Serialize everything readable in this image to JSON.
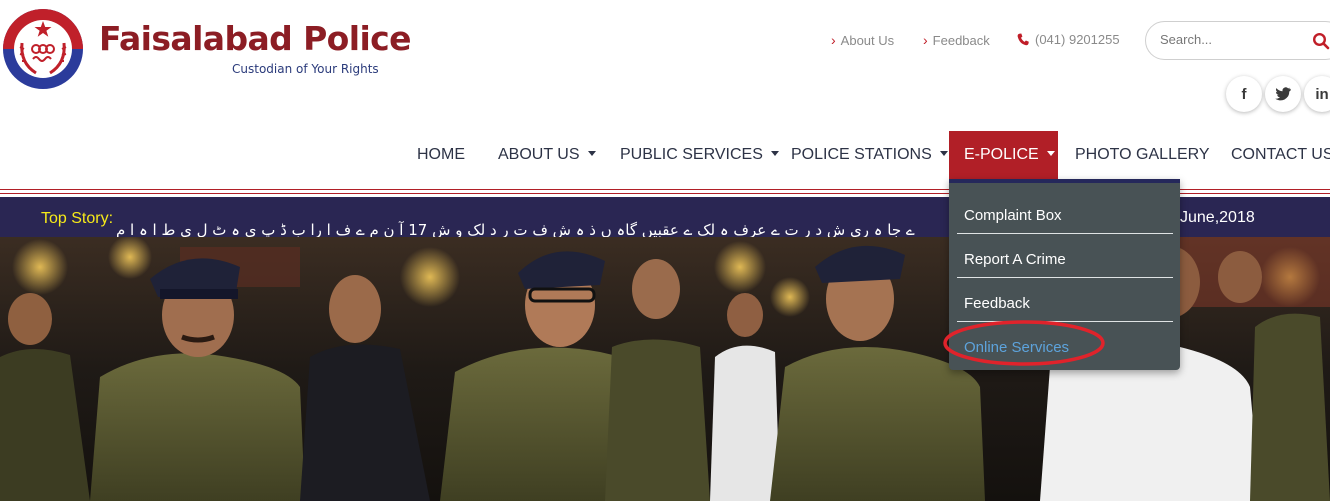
{
  "brand": {
    "name": "Faisalabad Police",
    "tagline": "Custodian of Your Rights"
  },
  "top_links": [
    {
      "label": "About Us"
    },
    {
      "label": "Feedback"
    }
  ],
  "phone": "(041) 9201255",
  "search": {
    "placeholder": "Search..."
  },
  "social": [
    {
      "icon": "facebook-icon",
      "glyph": "f"
    },
    {
      "icon": "twitter-icon",
      "glyph": "t"
    },
    {
      "icon": "linkedin-icon",
      "glyph": "in"
    }
  ],
  "nav": {
    "home": "HOME",
    "about": "ABOUT US",
    "public_services": "PUBLIC SERVICES",
    "police_stations": "POLICE STATIONS",
    "e_police": "E-POLICE",
    "photo_gallery": "PHOTO GALLERY",
    "contact": "CONTACT US"
  },
  "ticker": {
    "label": "Top Story:",
    "text": "ے جا ہ ری ش د ر ت ے عرف ہ لک ے عقبیں  گاہ ں ذ ہ ش ف ت ر د لک و ش 17  آ ن م ے ف ا را ب ڈ پ ی ہ ٹ ل ی ط ا ہ ا م",
    "date": "June,2018"
  },
  "dropdown": {
    "items": [
      {
        "label": "Complaint Box"
      },
      {
        "label": "Report A Crime"
      },
      {
        "label": "Feedback"
      },
      {
        "label": "Online Services"
      }
    ]
  },
  "colors": {
    "brand_red": "#b11f27",
    "brand_navy": "#2a2653",
    "ticker_label": "#f6ea19",
    "dropdown_bg": "#485255",
    "link_blue": "#5da3dc",
    "logo_blue": "#2b3b9b"
  }
}
